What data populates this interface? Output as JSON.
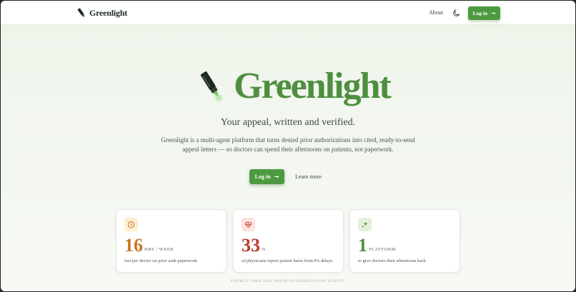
{
  "header": {
    "brand_name": "Greenlight",
    "about_label": "About",
    "login_label": "Log in"
  },
  "hero": {
    "title": "Greenlight",
    "tagline": "Your appeal, written and verified.",
    "description": "Greenlight is a multi-agent platform that turns denied prior authorizations into cited, ready-to-send appeal letters — so doctors can spend their afternoons on patients, not paperwork.",
    "login_label": "Log in",
    "learn_more_label": "Learn more"
  },
  "stats": [
    {
      "icon": "clock-icon",
      "number": "16",
      "unit": "HRS / WEEK",
      "description": "lost per doctor on prior auth paperwork",
      "color": "#c9772b",
      "icon_bg": "#fdf0cf"
    },
    {
      "icon": "heart-pulse-icon",
      "number": "33",
      "unit": "%",
      "description": "of physicians report patient harm from PA delays",
      "color": "#c0392b",
      "icon_bg": "#fde2e0"
    },
    {
      "icon": "sparkles-icon",
      "number": "1",
      "unit": "PLATFORM",
      "description": "to give doctors their afternoons back",
      "color": "#4e8f3f",
      "icon_bg": "#e3f1dc"
    }
  ],
  "source": "SOURCE: AMA 2024 PRIOR AUTHORIZATION SURVEY",
  "colors": {
    "brand_green": "#4e8f3f",
    "button_green": "#4c9a3f",
    "text_dark": "#1f2a20"
  }
}
